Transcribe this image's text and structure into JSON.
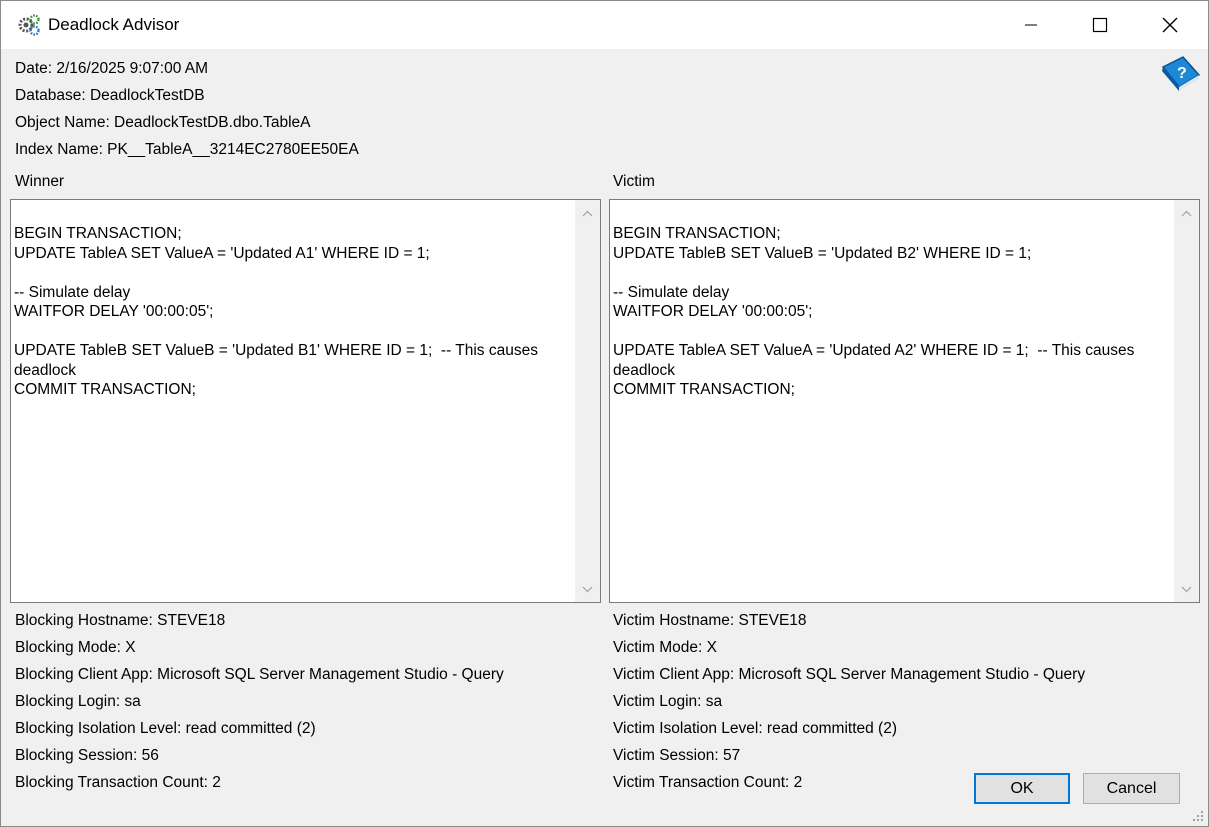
{
  "window": {
    "title": "Deadlock Advisor"
  },
  "info": {
    "date": "Date: 2/16/2025 9:07:00 AM",
    "database": "Database: DeadlockTestDB",
    "object_name": "Object Name: DeadlockTestDB.dbo.TableA",
    "index_name": "Index Name: PK__TableA__3214EC2780EE50EA"
  },
  "winner": {
    "heading": "Winner",
    "sql": "BEGIN TRANSACTION;\nUPDATE TableA SET ValueA = 'Updated A1' WHERE ID = 1;\n\n-- Simulate delay\nWAITFOR DELAY '00:00:05';\n\nUPDATE TableB SET ValueB = 'Updated B1' WHERE ID = 1;  -- This causes deadlock\nCOMMIT TRANSACTION;",
    "hostname": "Blocking Hostname: STEVE18",
    "mode": "Blocking Mode: X",
    "client_app": "Blocking Client App: Microsoft SQL Server Management Studio - Query",
    "login": "Blocking Login: sa",
    "isolation": "Blocking Isolation Level: read committed (2)",
    "session": "Blocking Session: 56",
    "tran_count": "Blocking Transaction Count: 2"
  },
  "victim": {
    "heading": "Victim",
    "sql": "BEGIN TRANSACTION;\nUPDATE TableB SET ValueB = 'Updated B2' WHERE ID = 1;\n\n-- Simulate delay\nWAITFOR DELAY '00:00:05';\n\nUPDATE TableA SET ValueA = 'Updated A2' WHERE ID = 1;  -- This causes deadlock\nCOMMIT TRANSACTION;",
    "hostname": "Victim Hostname: STEVE18",
    "mode": "Victim Mode: X",
    "client_app": "Victim Client App: Microsoft SQL Server Management Studio - Query",
    "login": "Victim Login: sa",
    "isolation": "Victim Isolation Level: read committed (2)",
    "session": "Victim Session: 57",
    "tran_count": "Victim Transaction Count: 2"
  },
  "buttons": {
    "ok": "OK",
    "cancel": "Cancel"
  },
  "icons": {
    "app": "gear-cluster-icon",
    "help": "help-book-icon",
    "minimize": "minimize-icon",
    "maximize": "maximize-icon",
    "close": "close-icon"
  },
  "colors": {
    "accent": "#0078d7",
    "help_blue": "#1e88d8"
  }
}
